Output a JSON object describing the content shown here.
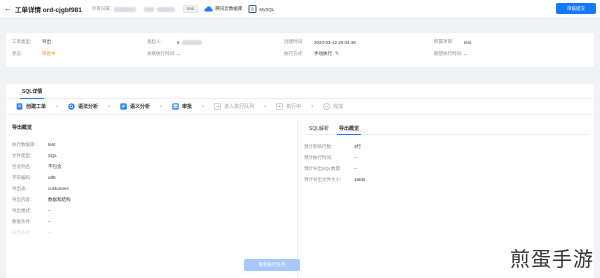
{
  "header": {
    "title": "工单详情 ord-cjgbf981",
    "meta1_label": "项目归属:",
    "meta2_label": "...",
    "env_tag": "test",
    "cloud_name": "腾讯云数据库",
    "db_name": "MySQL",
    "primary_button": "审核提交"
  },
  "info": {
    "row1": [
      {
        "label": "工单类型:",
        "value": "导出"
      },
      {
        "label": "发起人:",
        "value": "6"
      },
      {
        "label": "创建时间:",
        "value": "2024-03-12 20:04:46"
      },
      {
        "label": "所属项目:",
        "value": "test"
      }
    ],
    "row2": [
      {
        "label": "状态:",
        "value": "审批中"
      },
      {
        "label": "关联执行时间:",
        "value": "--"
      },
      {
        "label": "执行方式:",
        "value": "手动执行"
      },
      {
        "label": "期望执行时间:",
        "value": "--"
      }
    ]
  },
  "tabs": [
    "SQL详情"
  ],
  "steps": [
    {
      "label": "创建工单",
      "state": "done"
    },
    {
      "label": "语法分析",
      "state": "done"
    },
    {
      "label": "语义分析",
      "state": "done"
    },
    {
      "label": "审批",
      "state": "current"
    },
    {
      "label": "进入执行队列",
      "state": "pending"
    },
    {
      "label": "执行中",
      "state": "pending"
    },
    {
      "label": "完成",
      "state": "pending"
    }
  ],
  "left": {
    "title": "导出概览",
    "fields": [
      {
        "label": "执行数据库:",
        "value": "test"
      },
      {
        "label": "文件类型:",
        "value": "SQL"
      },
      {
        "label": "包含列名:",
        "value": "不包含"
      },
      {
        "label": "字符编码:",
        "value": "utf8"
      },
      {
        "label": "导出表:",
        "value": "customers"
      },
      {
        "label": "导出内容:",
        "value": "数据和结构"
      },
      {
        "label": "导出格式:",
        "value": "--"
      },
      {
        "label": "数据条件:",
        "value": "--"
      },
      {
        "label": "导出条件:",
        "value": "--"
      }
    ]
  },
  "right": {
    "tabs": [
      "SQL解析",
      "导出概览"
    ],
    "fields": [
      {
        "label": "预计影响行数:",
        "value": "3行"
      },
      {
        "label": "预计执行时间:",
        "value": "--"
      },
      {
        "label": "预计导出SQL数量:",
        "value": "--"
      },
      {
        "label": "预计导出文件大小:",
        "value": "16KB"
      }
    ]
  },
  "footer": {
    "button": "重新执行任务"
  },
  "watermark": "煎蛋手游"
}
